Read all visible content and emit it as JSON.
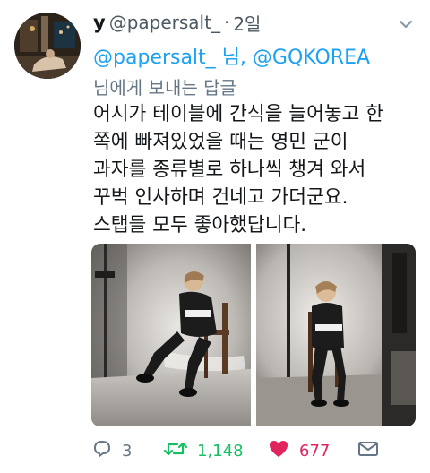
{
  "tweet": {
    "display_name": "y",
    "handle": "@papersalt_",
    "separator": "·",
    "time": "2일",
    "reply_to_text": "@papersalt_ 님, @GQKOREA",
    "reply_label": "님에게 보내는 답글",
    "body_lines": [
      "어시가 테이블에 간식을 늘어놓고 한",
      "쪽에 빠져있었을 때는 영민 군이",
      "과자를 종류별로 하나씩 챙겨 와서",
      "꾸벅 인사하며 건네고 가더군요.",
      "스탭들 모두 좋아했답니다."
    ]
  },
  "actions": {
    "reply_count": "3",
    "retweet_count": "1,148",
    "like_count": "677"
  },
  "colors": {
    "link": "#1da1f2",
    "secondary": "#657786",
    "retweet": "#17bf63",
    "like": "#e0245e"
  },
  "icons": [
    "avatar",
    "chevron-down-icon",
    "reply-icon",
    "retweet-icon",
    "heart-icon",
    "share-icon"
  ]
}
